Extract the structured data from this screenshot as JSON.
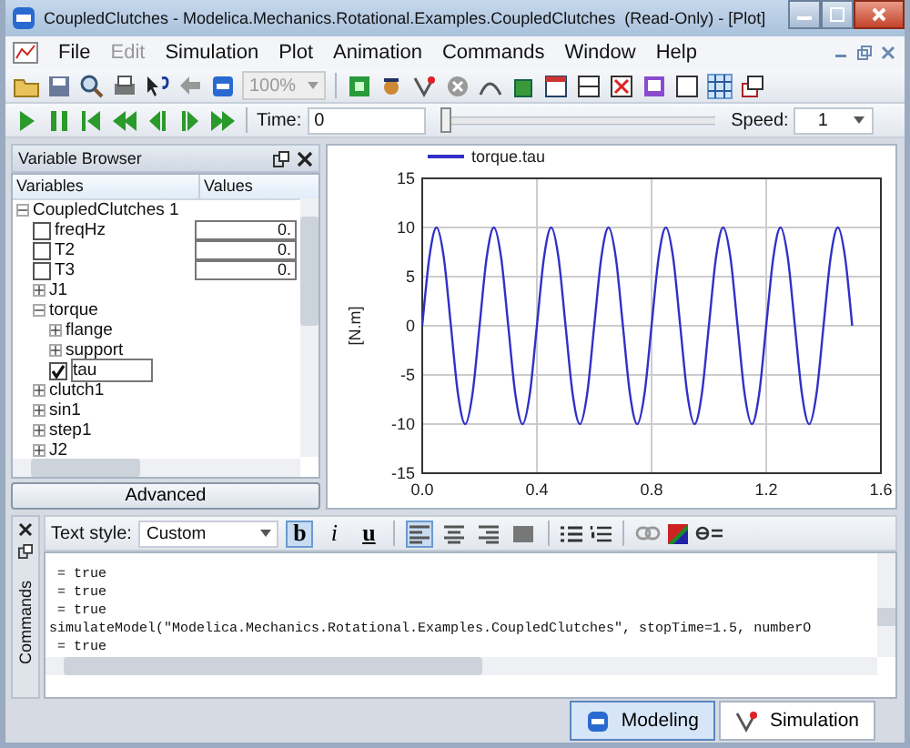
{
  "window": {
    "title": "CoupledClutches - Modelica.Mechanics.Rotational.Examples.CoupledClutches  (Read-Only) - [Plot]"
  },
  "menu": [
    {
      "label": "File",
      "disabled": false
    },
    {
      "label": "Edit",
      "disabled": true
    },
    {
      "label": "Simulation",
      "disabled": false
    },
    {
      "label": "Plot",
      "disabled": false
    },
    {
      "label": "Animation",
      "disabled": false
    },
    {
      "label": "Commands",
      "disabled": false
    },
    {
      "label": "Window",
      "disabled": false
    },
    {
      "label": "Help",
      "disabled": false
    }
  ],
  "toolbar": {
    "zoom": "100%"
  },
  "sim_toolbar": {
    "time_label": "Time:",
    "time_value": "0",
    "level": 0.0,
    "speed_label": "Speed:",
    "speed_value": "1"
  },
  "variable_browser": {
    "title": "Variable Browser",
    "columns": [
      "Variables",
      "Values"
    ],
    "tree": [
      {
        "label": "CoupledClutches 1",
        "kind": "group",
        "expanded": true,
        "selected": false,
        "children": [
          {
            "label": "freqHz",
            "kind": "checkbox",
            "checked": false,
            "selected": false,
            "value": "0."
          },
          {
            "label": "T2",
            "kind": "checkbox",
            "checked": false,
            "selected": false,
            "value": "0."
          },
          {
            "label": "T3",
            "kind": "checkbox",
            "checked": false,
            "selected": false,
            "value": "0."
          },
          {
            "label": "J1",
            "kind": "group",
            "expanded": false,
            "selected": false
          },
          {
            "label": "torque",
            "kind": "group",
            "expanded": true,
            "selected": false,
            "children": [
              {
                "label": "flange",
                "kind": "group",
                "expanded": false,
                "selected": false
              },
              {
                "label": "support",
                "kind": "group",
                "expanded": false,
                "selected": false
              },
              {
                "label": "tau",
                "kind": "checkbox",
                "checked": true,
                "selected": true
              }
            ]
          },
          {
            "label": "clutch1",
            "kind": "group",
            "expanded": false,
            "selected": false
          },
          {
            "label": "sin1",
            "kind": "group",
            "expanded": false,
            "selected": false
          },
          {
            "label": "step1",
            "kind": "group",
            "expanded": false,
            "selected": false
          },
          {
            "label": "J2",
            "kind": "group",
            "expanded": false,
            "selected": false
          }
        ]
      }
    ],
    "advanced_button": "Advanced"
  },
  "plot": {
    "chart_data": {
      "type": "line",
      "ylabel": "[N.m]",
      "grid": true,
      "xlim": [
        0,
        1.6
      ],
      "ylim": [
        -15,
        15
      ],
      "xticks": [
        {
          "value": 0,
          "label": "0.0"
        },
        0.4,
        0.8,
        1.2,
        1.6
      ],
      "yticks": [
        -15,
        -10,
        -5,
        0,
        5,
        10,
        15
      ],
      "x": [
        0,
        0.025,
        0.05,
        0.075,
        0.1,
        0.125,
        0.15,
        0.175,
        0.2,
        0.225,
        0.25,
        0.275,
        0.3,
        0.325,
        0.35,
        0.375,
        0.4,
        0.425,
        0.45,
        0.475,
        0.5,
        0.525,
        0.55,
        0.575,
        0.6,
        0.625,
        0.65,
        0.675,
        0.7,
        0.725,
        0.75,
        0.775,
        0.8,
        0.825,
        0.85,
        0.875,
        0.9,
        0.925,
        0.95,
        0.975,
        1,
        1.025,
        1.05,
        1.075,
        1.1,
        1.125,
        1.15,
        1.175,
        1.2,
        1.225,
        1.25,
        1.275,
        1.3,
        1.325,
        1.35,
        1.375,
        1.4,
        1.425,
        1.45,
        1.475,
        1.5
      ],
      "series": [
        {
          "name": "torque.tau",
          "color": "#3030c8",
          "values": [
            0,
            7,
            10,
            7,
            0,
            -7,
            -10,
            -7,
            0,
            7,
            10,
            7,
            0,
            -7,
            -10,
            -7,
            0,
            7,
            10,
            7,
            0,
            -7,
            -10,
            -7,
            0,
            7,
            10,
            7,
            0,
            -7,
            -10,
            -7,
            0,
            7,
            10,
            7,
            0,
            -7,
            -10,
            -7,
            0,
            7,
            10,
            7,
            0,
            -7,
            -10,
            -7,
            0,
            7,
            10,
            7,
            0,
            -7,
            -10,
            -7,
            0,
            7,
            10,
            7,
            0
          ]
        }
      ]
    }
  },
  "commands": {
    "tab_label": "Commands",
    "text_style_label": "Text style:",
    "text_style_value": "Custom",
    "format_buttons": [
      {
        "label": "b",
        "selected": true
      },
      {
        "label": "i",
        "selected": false
      },
      {
        "label": "u",
        "selected": false
      }
    ],
    "align_buttons": [
      {
        "selected": true
      },
      {
        "selected": false
      },
      {
        "selected": false
      },
      {
        "selected": false
      }
    ],
    "log": [
      " = true",
      " = true",
      " = true",
      "simulateModel(\"Modelica.Mechanics.Rotational.Examples.CoupledClutches\", stopTime=1.5, numberO",
      " = true"
    ]
  },
  "perspective_tabs": [
    {
      "label": "Modeling",
      "kind": "modeling",
      "selected": true
    },
    {
      "label": "Simulation",
      "kind": "simulation",
      "selected": false
    }
  ]
}
